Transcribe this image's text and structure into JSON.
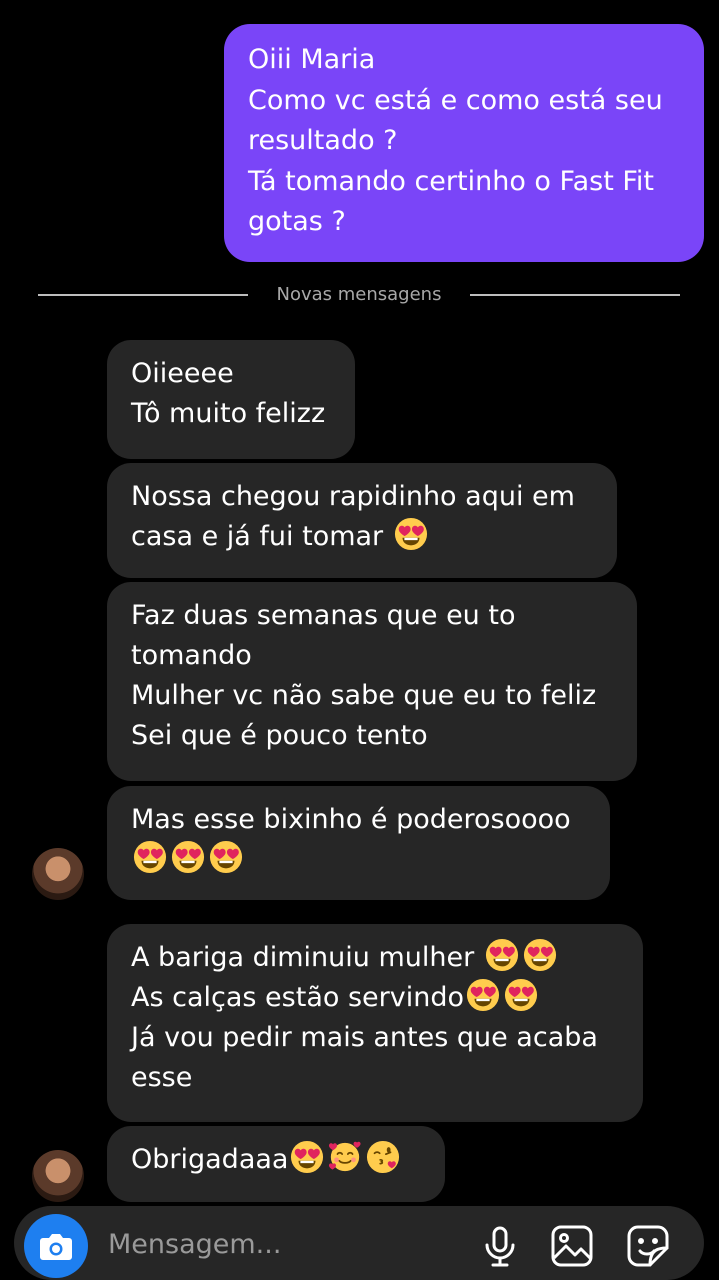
{
  "outgoing": {
    "lines": [
      "Oiii Maria",
      "Como vc está e como está seu",
      "resultado ?",
      "Tá tomando certinho o Fast Fit",
      "gotas ?"
    ]
  },
  "divider_label": "Novas mensagens",
  "messages": [
    {
      "lines": [
        "Oiieeee",
        "Tô muito felizz"
      ]
    },
    {
      "line1": "Nossa chegou rapidinho aqui em",
      "line2": "casa e já fui tomar",
      "emoji": "heart-eyes"
    },
    {
      "lines": [
        "Faz duas semanas que eu to",
        "tomando",
        "Mulher vc não sabe que eu to feliz",
        "Sei que é pouco tento"
      ]
    },
    {
      "line1": "Mas esse bixinho é poderosoooo",
      "emoji": "heart-eyes"
    },
    {
      "line1": "A bariga diminuiu mulher",
      "line2": "As calças estão servindo",
      "line3": "Já vou pedir mais antes que acaba",
      "line4": "esse",
      "emoji": "heart-eyes"
    },
    {
      "text": "Obrigadaaa",
      "emojis": [
        "heart-eyes",
        "smiling-face-with-hearts",
        "face-blowing-kiss"
      ]
    }
  ],
  "composer": {
    "placeholder": "Mensagem...",
    "icons": [
      "camera-icon",
      "microphone-icon",
      "gallery-icon",
      "sticker-icon"
    ]
  },
  "colors": {
    "background": "#000000",
    "outgoing_bubble": "#7a45f8",
    "incoming_bubble": "#262626",
    "camera_button": "#1e7ff0"
  }
}
